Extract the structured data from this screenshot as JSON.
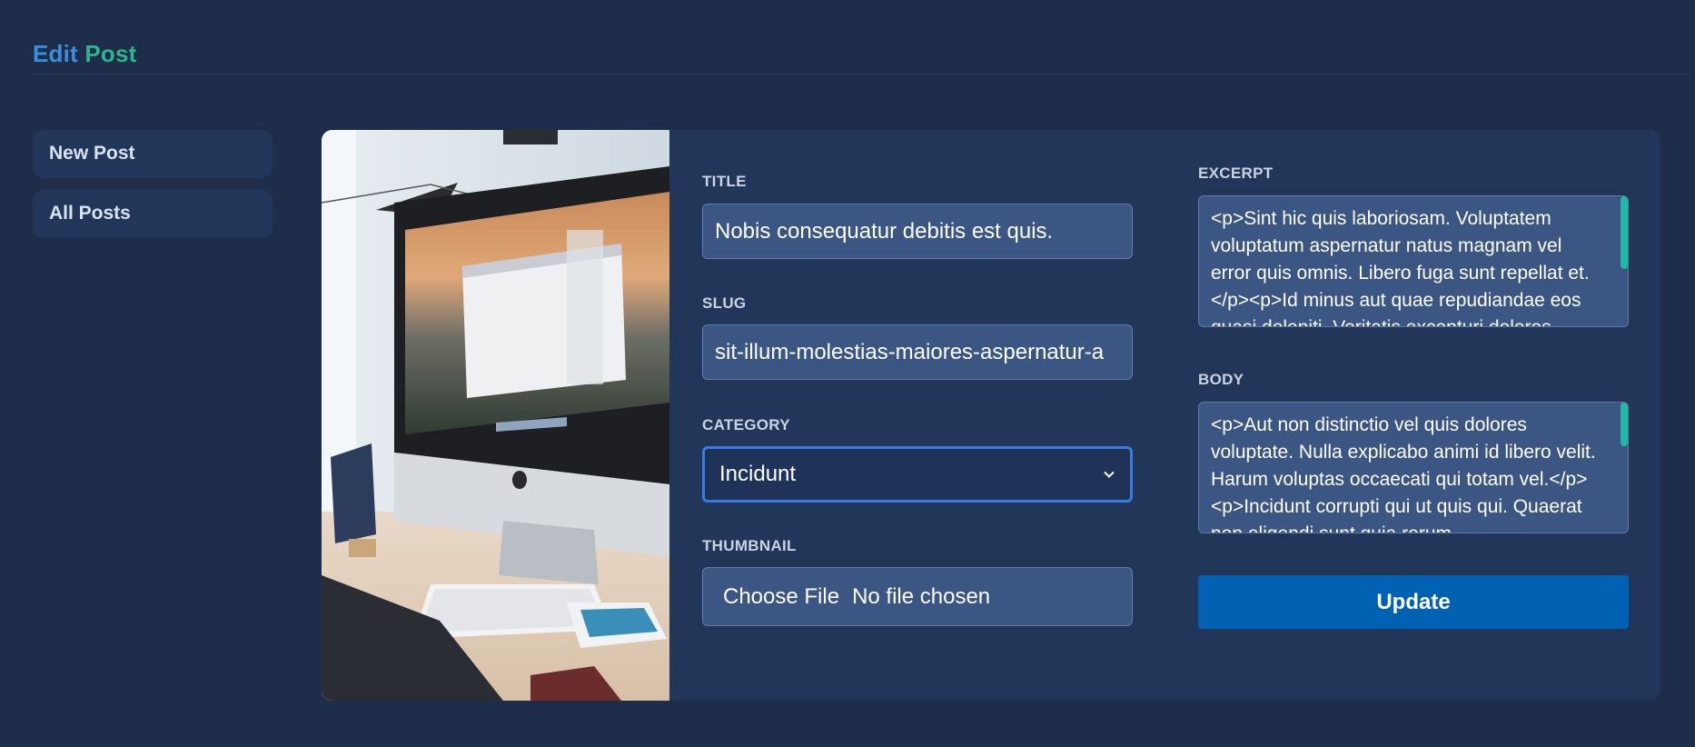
{
  "header": {
    "title_part1": "Edit",
    "title_part2": "Post"
  },
  "sidebar": {
    "items": [
      {
        "label": "New Post"
      },
      {
        "label": "All Posts"
      }
    ]
  },
  "form": {
    "title": {
      "label": "TITLE",
      "value": "Nobis consequatur debitis est quis."
    },
    "slug": {
      "label": "SLUG",
      "value": "sit-illum-molestias-maiores-aspernatur-a"
    },
    "category": {
      "label": "CATEGORY",
      "selected": "Incidunt"
    },
    "thumbnail": {
      "label": "THUMBNAIL",
      "button": "Choose File",
      "status": "No file chosen"
    },
    "excerpt": {
      "label": "EXCERPT",
      "value": "<p>Sint hic quis laboriosam. Voluptatem voluptatum aspernatur natus magnam vel error quis omnis. Libero fuga sunt repellat et.</p><p>Id minus aut quae repudiandae eos quasi deleniti. Veritatis excepturi dolores"
    },
    "body": {
      "label": "BODY",
      "value": "<p>Aut non distinctio vel quis dolores voluptate. Nulla explicabo animi id libero velit. Harum voluptas occaecati qui totam vel.</p><p>Incidunt corrupti qui ut quis qui. Quaerat non eligendi sunt quia rerum"
    },
    "submit": "Update"
  },
  "colors": {
    "background": "#1e2d4a",
    "card": "#223659",
    "title_blue": "#3a8fdc",
    "title_green": "#2bb58e",
    "button": "#0162b3",
    "scroll_thumb": "#20b8a6"
  },
  "icons": {
    "select_caret": "chevron-down-icon"
  }
}
